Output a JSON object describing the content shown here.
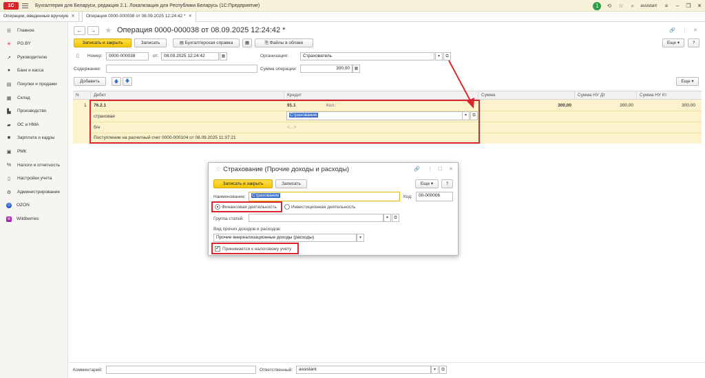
{
  "window": {
    "logo_text": "1С",
    "app_title": "Бухгалтерия для Беларуси, редакция 2.1. Локализация для Республики Беларусь   (1С:Предприятие)",
    "bell_count": "1",
    "user": "assistant"
  },
  "tabs": [
    {
      "label": "Операции, введенные вручную"
    },
    {
      "label": "Операция 0000-000038 от 08.09.2025 12:24:42 *"
    }
  ],
  "sidebar": {
    "items": [
      {
        "label": "Главное",
        "icon": "menu-icon"
      },
      {
        "label": "PO.BY",
        "icon": "asterisk-icon"
      },
      {
        "label": "Руководителю",
        "icon": "trend-icon"
      },
      {
        "label": "Банк и касса",
        "icon": "coin-icon"
      },
      {
        "label": "Покупки и продажи",
        "icon": "cart-icon"
      },
      {
        "label": "Склад",
        "icon": "warehouse-icon"
      },
      {
        "label": "Производство",
        "icon": "factory-icon"
      },
      {
        "label": "ОС и НМА",
        "icon": "truck-icon"
      },
      {
        "label": "Зарплата и кадры",
        "icon": "people-icon"
      },
      {
        "label": "РМК",
        "icon": "register-icon"
      },
      {
        "label": "Налоги и отчетность",
        "icon": "percent-icon"
      },
      {
        "label": "Настройки учета",
        "icon": "document-icon"
      },
      {
        "label": "Администрирование",
        "icon": "gear-icon"
      },
      {
        "label": "OZON",
        "icon": "ozon-icon",
        "badge": "O"
      },
      {
        "label": "Wildberries",
        "icon": "wildberries-icon",
        "badge": "W"
      }
    ]
  },
  "document": {
    "title": "Операция 0000-000038 от 08.09.2025 12:24:42 *",
    "toolbar": {
      "save_close": "Записать и закрыть",
      "save": "Записать",
      "accounting_ref": "Бухгалтерская справка",
      "files": "Файлы в облаке",
      "more": "Еще"
    },
    "fields": {
      "number_label": "Номер:",
      "number_value": "0000-000038",
      "date_label": "от:",
      "date_value": "08.09.2025 12:24:42",
      "org_label": "Организация:",
      "org_value": "Страхователь",
      "content_label": "Содержание:",
      "content_value": "",
      "sum_label": "Сумма операции:",
      "sum_value": "300,00"
    },
    "table_toolbar": {
      "add": "Добавить",
      "more": "Еще"
    },
    "columns": [
      "N",
      "Дебет",
      "Кредит",
      "Сумма",
      "Сумма НУ Дт",
      "Сумма НУ Кт"
    ],
    "row": {
      "n": "1",
      "debit_account": "76.2.1",
      "debit_sub1": "страховая",
      "debit_sub2": "б/н",
      "debit_sub3": "Поступление на расчетный счет 0000-000104 от 08.09.2025 11:37:21",
      "credit_account": "91.1",
      "qty_label": "Кол.:",
      "credit_sub1": "Страхование",
      "credit_sub2": "<...>",
      "sum": "300,00",
      "sum_nu_dt": "300,00",
      "sum_nu_kt": "300,00"
    },
    "footer": {
      "comment_label": "Комментарий:",
      "comment_value": "",
      "responsible_label": "Ответственный:",
      "responsible_value": "assistant"
    }
  },
  "dialog": {
    "title": "Страхование (Прочие доходы и расходы)",
    "save_close": "Записать и закрыть",
    "save": "Записать",
    "more": "Еще",
    "help": "?",
    "name_label": "Наименование:",
    "name_value": "Страхование",
    "code_label": "Код:",
    "code_value": "00-000006",
    "radio_financial": "Финансовая деятельность",
    "radio_investment": "Инвестиционная деятельность",
    "group_label": "Группа статей:",
    "group_value": "",
    "kind_label": "Вид прочих доходов и расходов:",
    "kind_value": "Прочие внереализационные доходы (расходы)",
    "tax_checkbox": "Принимается к налоговому учету"
  },
  "colors": {
    "accent_yellow": "#f5c400",
    "highlight_red": "#d9262c",
    "row_yellow": "#fcf3cc",
    "selection_blue": "#3a6fc7"
  }
}
